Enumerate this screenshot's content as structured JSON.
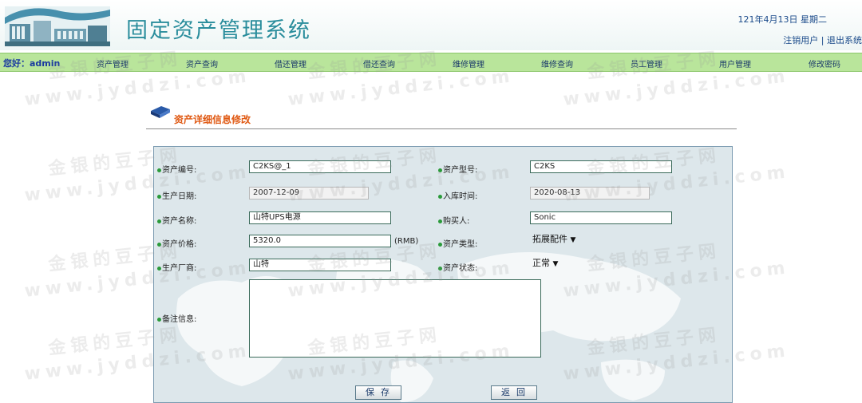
{
  "header": {
    "system_title": "固定资产管理系统",
    "date": "121年4月13日  星期二",
    "logout_user": "注销用户",
    "separator": "|",
    "exit_system": "退出系统"
  },
  "nav": {
    "greeting": "您好：admin",
    "items": [
      "资产管理",
      "资产查询",
      "借还管理",
      "借还查询",
      "维修管理",
      "维修查询",
      "员工管理",
      "用户管理",
      "修改密码"
    ]
  },
  "watermarks": {
    "cn": "金银的豆子网",
    "en": "www.jyddzi.com"
  },
  "section": {
    "title": "资产详细信息修改"
  },
  "form": {
    "asset_no": {
      "label": "资产编号:",
      "value": "C2KS@_1"
    },
    "asset_model": {
      "label": "资产型号:",
      "value": "C2KS"
    },
    "production_date": {
      "label": "生产日期:",
      "value": "2007-12-09"
    },
    "storage_date": {
      "label": "入库时间:",
      "value": "2020-08-13"
    },
    "asset_name": {
      "label": "资产名称:",
      "value": "山特UPS电源"
    },
    "buyer": {
      "label": "购买人:",
      "value": "Sonic"
    },
    "asset_price": {
      "label": "资产价格:",
      "value": "5320.0",
      "unit": "(RMB)"
    },
    "asset_type": {
      "label": "资产类型:",
      "value": "拓展配件"
    },
    "manufacturer": {
      "label": "生产厂商:",
      "value": "山特"
    },
    "asset_status": {
      "label": "资产状态:",
      "value": "正常"
    },
    "notes": {
      "label": "备注信息:",
      "value": ""
    }
  },
  "buttons": {
    "save": "保存",
    "back": "返回"
  },
  "colors": {
    "nav_bg": "#b9e59b",
    "title_color": "#2a8d9c",
    "section_title": "#e05a14",
    "label_dot": "#2a9a3a"
  }
}
